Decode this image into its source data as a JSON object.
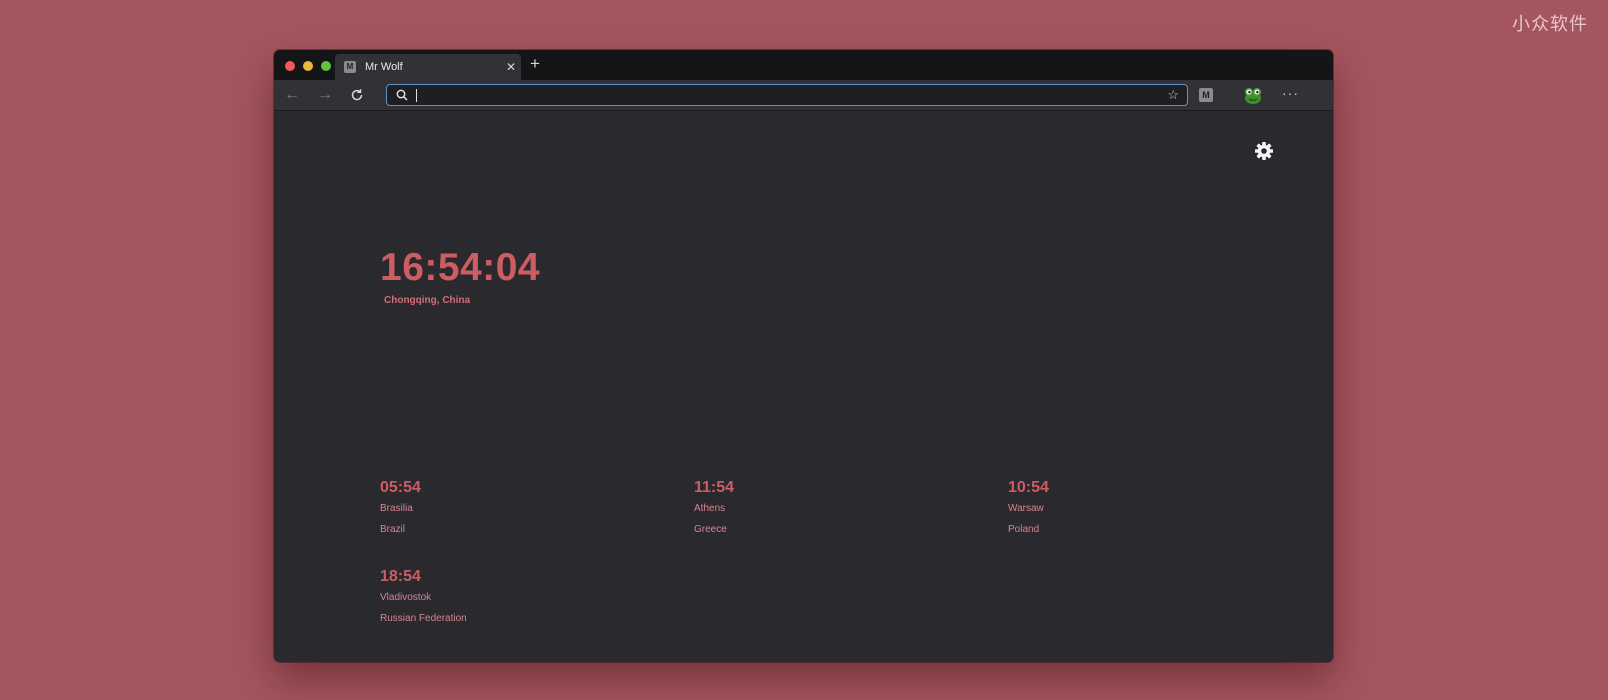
{
  "watermark": "小众软件",
  "browser": {
    "tab": {
      "title": "Mr Wolf",
      "favicon_letter": "M"
    },
    "new_tab_label": "+",
    "address": {
      "value": "",
      "placeholder": ""
    },
    "extension_letter": "M",
    "more_label": "···"
  },
  "page": {
    "main_clock": {
      "time": "16:54:04",
      "location": "Chongqing, China"
    },
    "cities": [
      {
        "time": "05:54",
        "city": "Brasilia",
        "country": "Brazil"
      },
      {
        "time": "11:54",
        "city": "Athens",
        "country": "Greece"
      },
      {
        "time": "10:54",
        "city": "Warsaw",
        "country": "Poland"
      },
      {
        "time": "18:54",
        "city": "Vladivostok",
        "country": "Russian Federation"
      }
    ]
  },
  "colors": {
    "background": "#a5555d",
    "page_bg": "#2a292e",
    "clock_accent": "#cc5d62",
    "label": "#d58593",
    "address_border": "#5b93c9"
  },
  "icons": [
    "back-arrow-icon",
    "forward-arrow-icon",
    "reload-icon",
    "search-icon",
    "star-icon",
    "frog-extension-icon",
    "gear-icon",
    "close-icon"
  ]
}
